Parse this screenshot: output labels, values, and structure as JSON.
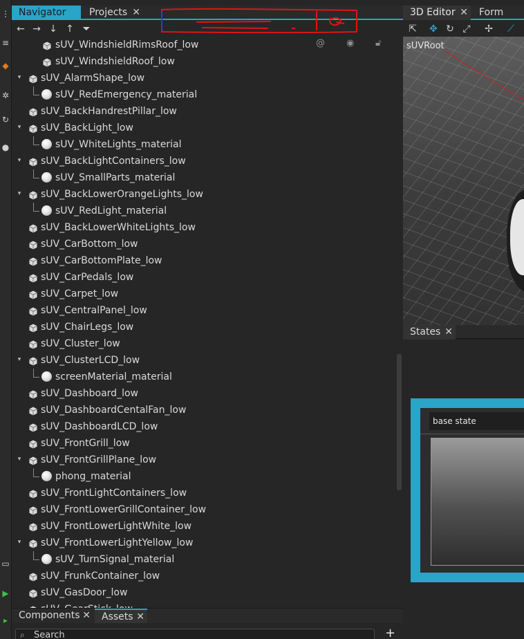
{
  "navigator": {
    "tabs": [
      {
        "label": "Navigator",
        "active": true
      },
      {
        "label": "Projects",
        "active": false
      }
    ],
    "toolbar_icons": [
      "arrow-left-icon",
      "arrow-right-icon",
      "arrow-down-icon",
      "arrow-up-icon",
      "filter-icon"
    ],
    "row_icons": [
      "export-icon",
      "visibility-icon",
      "lock-icon"
    ],
    "tree": [
      {
        "label": "sUV_WindshieldRimsRoof_low",
        "level": 1,
        "type": "node"
      },
      {
        "label": "sUV_WindshieldRoof_low",
        "level": 1,
        "type": "node"
      },
      {
        "label": "sUV_AlarmShape_low",
        "level": 0,
        "type": "node",
        "expanded": true
      },
      {
        "label": "sUV_RedEmergency_material",
        "level": 1,
        "type": "material"
      },
      {
        "label": "sUV_BackHandrestPillar_low",
        "level": 0,
        "type": "node"
      },
      {
        "label": "sUV_BackLight_low",
        "level": 0,
        "type": "node",
        "expanded": true
      },
      {
        "label": "sUV_WhiteLights_material",
        "level": 1,
        "type": "material"
      },
      {
        "label": "sUV_BackLightContainers_low",
        "level": 0,
        "type": "node",
        "expanded": true
      },
      {
        "label": "sUV_SmallParts_material",
        "level": 1,
        "type": "material"
      },
      {
        "label": "sUV_BackLowerOrangeLights_low",
        "level": 0,
        "type": "node",
        "expanded": true
      },
      {
        "label": "sUV_RedLight_material",
        "level": 1,
        "type": "material"
      },
      {
        "label": "sUV_BackLowerWhiteLights_low",
        "level": 0,
        "type": "node"
      },
      {
        "label": "sUV_CarBottom_low",
        "level": 0,
        "type": "node"
      },
      {
        "label": "sUV_CarBottomPlate_low",
        "level": 0,
        "type": "node"
      },
      {
        "label": "sUV_CarPedals_low",
        "level": 0,
        "type": "node"
      },
      {
        "label": "sUV_Carpet_low",
        "level": 0,
        "type": "node"
      },
      {
        "label": "sUV_CentralPanel_low",
        "level": 0,
        "type": "node"
      },
      {
        "label": "sUV_ChairLegs_low",
        "level": 0,
        "type": "node"
      },
      {
        "label": "sUV_Cluster_low",
        "level": 0,
        "type": "node"
      },
      {
        "label": "sUV_ClusterLCD_low",
        "level": 0,
        "type": "node",
        "expanded": true
      },
      {
        "label": "screenMaterial_material",
        "level": 1,
        "type": "material"
      },
      {
        "label": "sUV_Dashboard_low",
        "level": 0,
        "type": "node"
      },
      {
        "label": "sUV_DashboardCentalFan_low",
        "level": 0,
        "type": "node"
      },
      {
        "label": "sUV_DashboardLCD_low",
        "level": 0,
        "type": "node"
      },
      {
        "label": "sUV_FrontGrill_low",
        "level": 0,
        "type": "node"
      },
      {
        "label": "sUV_FrontGrillPlane_low",
        "level": 0,
        "type": "node",
        "expanded": true
      },
      {
        "label": "phong_material",
        "level": 1,
        "type": "material"
      },
      {
        "label": "sUV_FrontLightContainers_low",
        "level": 0,
        "type": "node"
      },
      {
        "label": "sUV_FrontLowerGrillContainer_low",
        "level": 0,
        "type": "node"
      },
      {
        "label": "sUV_FrontLowerLightWhite_low",
        "level": 0,
        "type": "node"
      },
      {
        "label": "sUV_FrontLowerLightYellow_low",
        "level": 0,
        "type": "node",
        "expanded": true
      },
      {
        "label": "sUV_TurnSignal_material",
        "level": 1,
        "type": "material"
      },
      {
        "label": "sUV_FrunkContainer_low",
        "level": 0,
        "type": "node"
      },
      {
        "label": "sUV_GasDoor_low",
        "level": 0,
        "type": "node"
      },
      {
        "label": "sUV_GearStick_low",
        "level": 0,
        "type": "node"
      }
    ]
  },
  "bottom_panel": {
    "tabs": [
      {
        "label": "Components",
        "active": false
      },
      {
        "label": "Assets",
        "active": true
      }
    ],
    "search_placeholder": "Search",
    "add_label": "+"
  },
  "editor": {
    "tabs": [
      {
        "label": "3D Editor",
        "active": true
      },
      {
        "label": "Form Editor",
        "active": false
      }
    ],
    "viewport_root_label": "sUVRoot",
    "toolbar_icons": [
      "select-icon",
      "move-icon",
      "rotate-icon",
      "scale-icon",
      "fit-icon",
      "snap-icon"
    ]
  },
  "states": {
    "tab_label": "States",
    "state_name": "base state"
  },
  "colors": {
    "accent": "#2aa4c7",
    "panel_bg": "#262626",
    "annotation": "#e01414"
  }
}
